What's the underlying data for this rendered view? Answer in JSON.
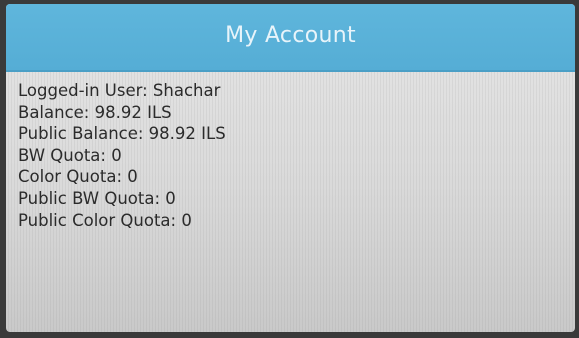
{
  "header": {
    "title": "My Account"
  },
  "account": {
    "lines": [
      "Logged-in User: Shachar",
      "Balance: 98.92 ILS",
      "Public Balance: 98.92 ILS",
      "BW Quota: 0",
      "Color Quota: 0",
      "Public BW Quota: 0",
      "Public Color Quota: 0"
    ]
  },
  "colors": {
    "title_bar": "#55add5",
    "title_text": "#e8f4fa",
    "body_text": "#2b2b2b"
  }
}
